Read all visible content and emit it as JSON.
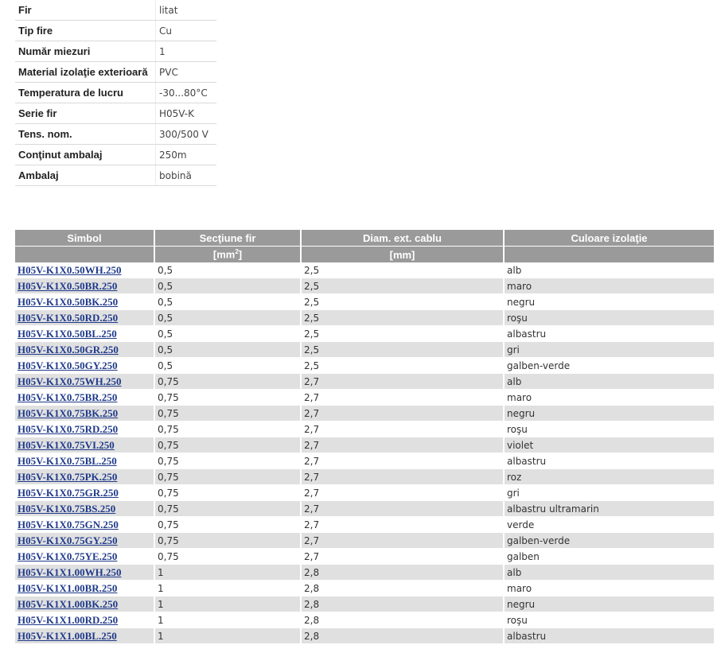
{
  "specs": [
    {
      "label": "Fir",
      "value": "litat"
    },
    {
      "label": "Tip fire",
      "value": "Cu"
    },
    {
      "label": "Număr miezuri",
      "value": "1"
    },
    {
      "label": "Material izolaţie exterioară",
      "value": "PVC"
    },
    {
      "label": "Temperatura de lucru",
      "value": "-30...80°C"
    },
    {
      "label": "Serie fir",
      "value": "H05V-K"
    },
    {
      "label": "Tens. nom.",
      "value": "300/500 V"
    },
    {
      "label": "Conţinut ambalaj",
      "value": "250m"
    },
    {
      "label": "Ambalaj",
      "value": "bobină"
    }
  ],
  "table": {
    "headers": [
      "Simbol",
      "Secţiune fir",
      "Diam. ext. cablu",
      "Culoare izolaţie"
    ],
    "units": [
      "",
      "[mm",
      "[mm]",
      ""
    ],
    "unit_superscript": "2",
    "unit_close": "]",
    "rows": [
      [
        "H05V-K1X0.50WH.250",
        "0,5",
        "2,5",
        "alb"
      ],
      [
        "H05V-K1X0.50BR.250",
        "0,5",
        "2,5",
        "maro"
      ],
      [
        "H05V-K1X0.50BK.250",
        "0,5",
        "2,5",
        "negru"
      ],
      [
        "H05V-K1X0.50RD.250",
        "0,5",
        "2,5",
        "roşu"
      ],
      [
        "H05V-K1X0.50BL.250",
        "0,5",
        "2,5",
        "albastru"
      ],
      [
        "H05V-K1X0.50GR.250",
        "0,5",
        "2,5",
        "gri"
      ],
      [
        "H05V-K1X0.50GY.250",
        "0,5",
        "2,5",
        "galben-verde"
      ],
      [
        "H05V-K1X0.75WH.250",
        "0,75",
        "2,7",
        "alb"
      ],
      [
        "H05V-K1X0.75BR.250",
        "0,75",
        "2,7",
        "maro"
      ],
      [
        "H05V-K1X0.75BK.250",
        "0,75",
        "2,7",
        "negru"
      ],
      [
        "H05V-K1X0.75RD.250",
        "0,75",
        "2,7",
        "roşu"
      ],
      [
        "H05V-K1X0.75VI.250",
        "0,75",
        "2,7",
        "violet"
      ],
      [
        "H05V-K1X0.75BL.250",
        "0,75",
        "2,7",
        "albastru"
      ],
      [
        "H05V-K1X0.75PK.250",
        "0,75",
        "2,7",
        "roz"
      ],
      [
        "H05V-K1X0.75GR.250",
        "0,75",
        "2,7",
        "gri"
      ],
      [
        "H05V-K1X0.75BS.250",
        "0,75",
        "2,7",
        "albastru ultramarin"
      ],
      [
        "H05V-K1X0.75GN.250",
        "0,75",
        "2,7",
        "verde"
      ],
      [
        "H05V-K1X0.75GY.250",
        "0,75",
        "2,7",
        "galben-verde"
      ],
      [
        "H05V-K1X0.75YE.250",
        "0,75",
        "2,7",
        "galben"
      ],
      [
        "H05V-K1X1.00WH.250",
        "1",
        "2,8",
        "alb"
      ],
      [
        "H05V-K1X1.00BR.250",
        "1",
        "2,8",
        "maro"
      ],
      [
        "H05V-K1X1.00BK.250",
        "1",
        "2,8",
        "negru"
      ],
      [
        "H05V-K1X1.00RD.250",
        "1",
        "2,8",
        "roşu"
      ],
      [
        "H05V-K1X1.00BL.250",
        "1",
        "2,8",
        "albastru"
      ]
    ]
  },
  "colors": {
    "header_bg": "#9a9a9a",
    "row_alt_bg": "#e0e0e0",
    "link": "#1f3a8a"
  }
}
